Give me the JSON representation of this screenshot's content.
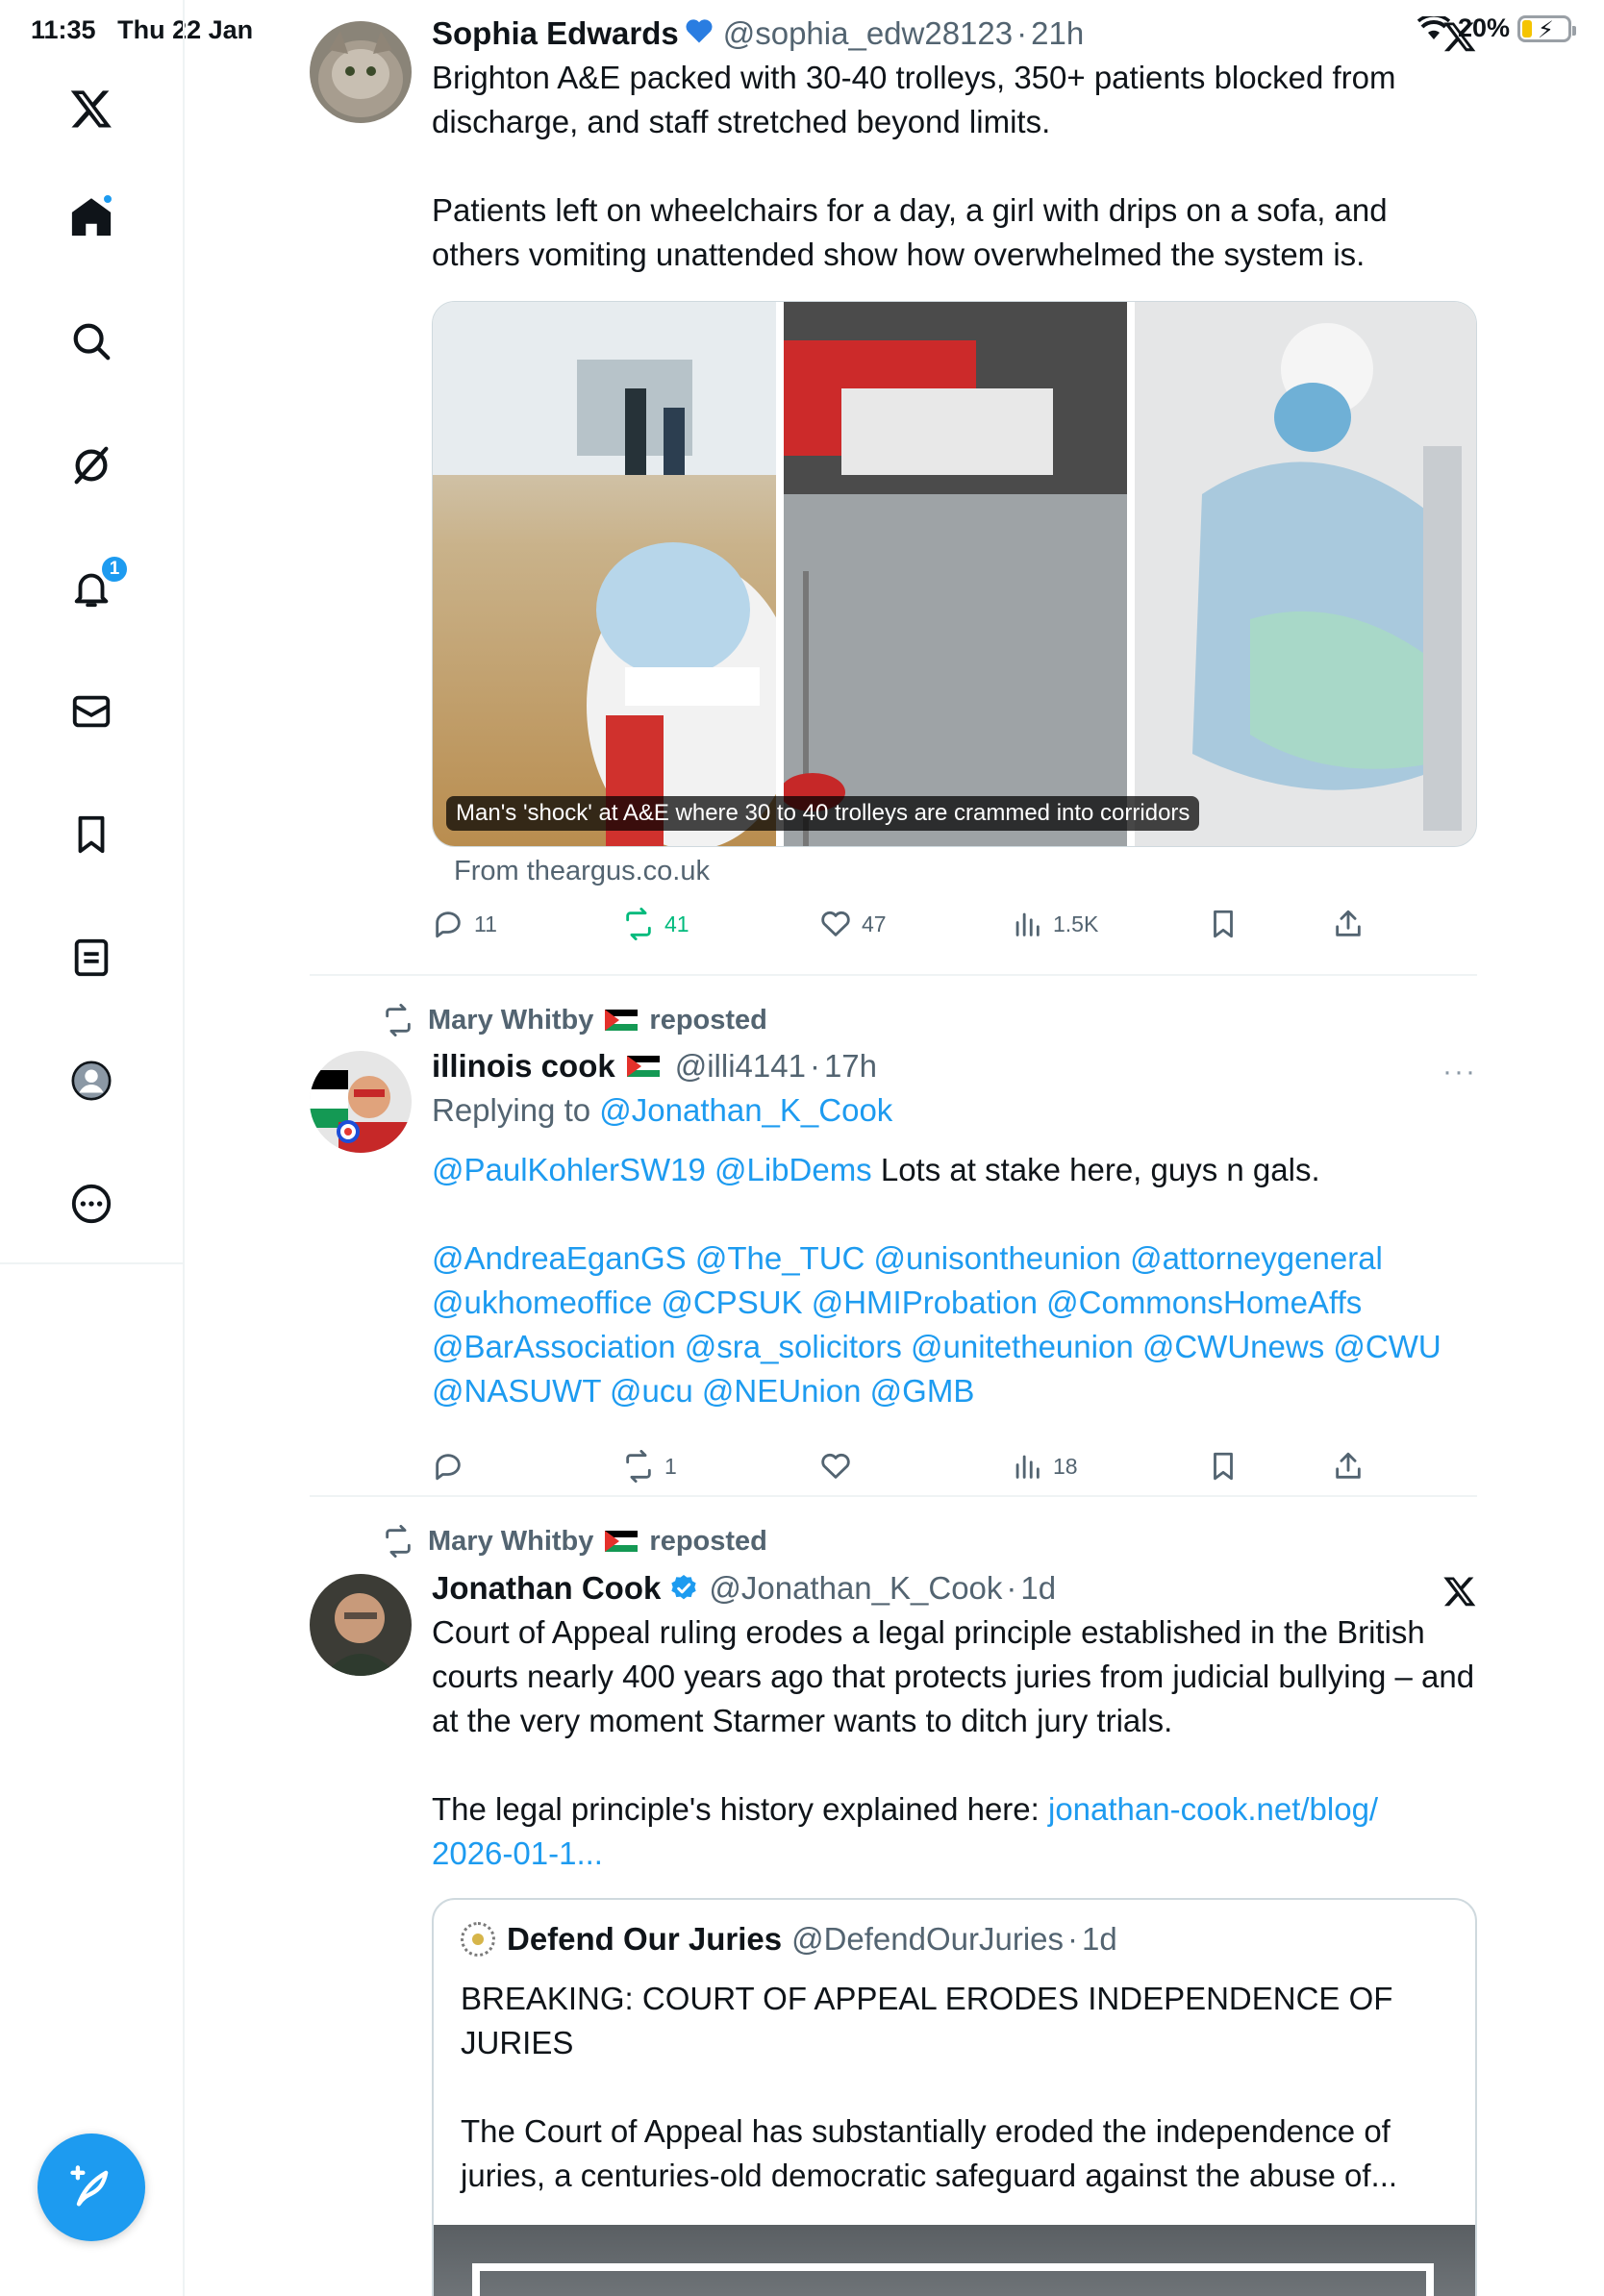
{
  "status_bar": {
    "time": "11:35",
    "date": "Thu 22 Jan",
    "battery": "20%"
  },
  "sidebar": {
    "items": [
      {
        "name": "x-logo-icon"
      },
      {
        "name": "home-icon"
      },
      {
        "name": "search-icon"
      },
      {
        "name": "grok-icon"
      },
      {
        "name": "bell-icon",
        "badge": "1"
      },
      {
        "name": "mail-icon"
      },
      {
        "name": "bookmark-icon"
      },
      {
        "name": "lists-icon"
      },
      {
        "name": "profile-icon"
      },
      {
        "name": "more-icon"
      }
    ],
    "compose_icon": "compose-icon"
  },
  "colors": {
    "accent": "#1d9bf0",
    "repost_green": "#00ba7c",
    "muted": "#536471",
    "divider": "#eff3f4"
  },
  "posts": [
    {
      "author": "Sophia Edwards",
      "handle": "@sophia_edw28123",
      "time": "21h",
      "text": "Brighton A&E packed with 30-40 trolleys, 350+ patients blocked from discharge, and staff stretched beyond limits.\n\nPatients left on wheelchairs for a day, a girl with drips on a sofa, and others vomiting unattended show how overwhelmed the system is.",
      "media_caption": "Man's 'shock' at A&E where 30 to 40 trolleys are crammed into corridors",
      "source": "From theargus.co.uk",
      "stats": {
        "replies": "11",
        "reposts": "41",
        "likes": "47",
        "views": "1.5K"
      }
    },
    {
      "repost_by": "Mary Whitby",
      "repost_suffix": "reposted",
      "author": "illinois cook",
      "handle": "@illi4141",
      "time": "17h",
      "more": "···",
      "replying_prefix": "Replying to ",
      "replying_to": "@Jonathan_K_Cook",
      "mentions_line1": "@PaulKohlerSW19 @LibDems",
      "text_line1": " Lots at stake here, guys n gals.",
      "mentions_block": "@AndreaEganGS @The_TUC @unisontheunion @attorneygeneral\n@ukhomeoffice @CPSUK @HMIProbation @CommonsHomeAffs\n@BarAssociation @sra_solicitors @unitetheunion @CWUnews @CWU\n@NASUWT @ucu @NEUnion @GMB",
      "stats": {
        "replies": "",
        "reposts": "1",
        "likes": "",
        "views": "18"
      }
    },
    {
      "repost_by": "Mary Whitby",
      "repost_suffix": "reposted",
      "author": "Jonathan Cook",
      "handle": "@Jonathan_K_Cook",
      "time": "1d",
      "text": "Court of Appeal ruling erodes a legal principle established in the British courts nearly 400 years ago that protects juries from judicial bullying – and at the very moment Starmer wants to ditch jury trials.\n\nThe legal principle's history explained here: ",
      "link": "jonathan-cook.net/blog/\n2026-01-1...",
      "quote": {
        "author": "Defend Our Juries",
        "handle": "@DefendOurJuries",
        "time": "1d",
        "text": "BREAKING: COURT OF APPEAL ERODES INDEPENDENCE OF JURIES\n\nThe Court of Appeal has substantially eroded the independence of juries, a centuries-old democratic safeguard against the abuse of..."
      }
    }
  ]
}
